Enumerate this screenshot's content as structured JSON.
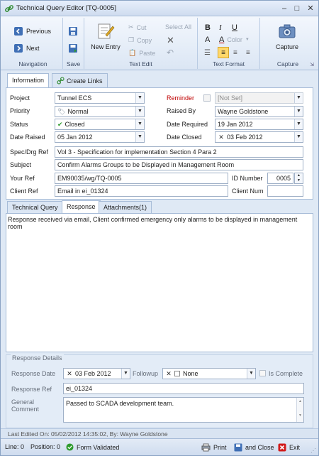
{
  "window": {
    "title": "Technical Query Editor [TQ-0005]",
    "minimize": "–",
    "maximize": "□",
    "close": "✕"
  },
  "ribbon": {
    "navigation": {
      "label": "Navigation",
      "previous": "Previous",
      "next": "Next"
    },
    "save": {
      "label": "Save"
    },
    "text_edit": {
      "label": "Text Edit",
      "new_entry": "New Entry",
      "cut": "Cut",
      "copy": "Copy",
      "paste": "Paste",
      "select_all": "Select All"
    },
    "text_format": {
      "label": "Text Format",
      "bold": "B",
      "italic": "I",
      "underline": "U",
      "color": "Color"
    },
    "capture": {
      "label": "Capture",
      "capture": "Capture"
    }
  },
  "info_tabs": [
    {
      "label": "Information"
    },
    {
      "label": "Create Links"
    }
  ],
  "form": {
    "project_label": "Project",
    "project_value": "Tunnel ECS",
    "priority_label": "Priority",
    "priority_value": "Normal",
    "status_label": "Status",
    "status_value": "Closed",
    "date_raised_label": "Date Raised",
    "date_raised_value": "05 Jan 2012",
    "reminder_label": "Reminder",
    "reminder_value": "[Not Set]",
    "raised_by_label": "Raised By",
    "raised_by_value": "Wayne Goldstone",
    "date_required_label": "Date Required",
    "date_required_value": "19 Jan 2012",
    "date_closed_label": "Date Closed",
    "date_closed_value": "03 Feb 2012",
    "spec_label": "Spec/Drg Ref",
    "spec_value": "Vol 3 - Specification for implementation Section 4 Para 2",
    "subject_label": "Subject",
    "subject_value": "Confirm Alarms Groups to be Displayed in Management Room",
    "your_ref_label": "Your Ref",
    "your_ref_value": "EM90035/wg/TQ-0005",
    "id_number_label": "ID Number",
    "id_number_value": "0005",
    "client_ref_label": "Client Ref",
    "client_ref_value": "Email in ei_01324",
    "client_num_label": "Client Num",
    "client_num_value": ""
  },
  "resp_tabs": [
    {
      "label": "Technical Query"
    },
    {
      "label": "Response"
    },
    {
      "label": "Attachments(1)"
    }
  ],
  "response_text": "Response received via email, Client confirmed emergency only alarms to be displayed in management room",
  "details": {
    "legend": "Response Details",
    "response_date_label": "Response Date",
    "response_date_value": "03 Feb 2012",
    "followup_label": "Followup",
    "followup_value": "None",
    "is_complete_label": "Is Complete",
    "response_ref_label": "Response Ref",
    "response_ref_value": "ei_01324",
    "general_comment_label_1": "General",
    "general_comment_label_2": "Comment",
    "general_comment_value": "Passed to SCADA development team."
  },
  "last_edited": "Last Edited On: 05/02/2012 14:35:02, By: Wayne Goldstone",
  "statusbar": {
    "line": "Line: 0",
    "position": "Position: 0",
    "validated": "Form Validated",
    "print": "Print",
    "and_close": "and Close",
    "exit": "Exit"
  },
  "colors": {
    "accent": "#3f6fb5",
    "reminder": "#c00000",
    "ok_green": "#2e9b2e",
    "exit_red": "#d11b1b"
  }
}
